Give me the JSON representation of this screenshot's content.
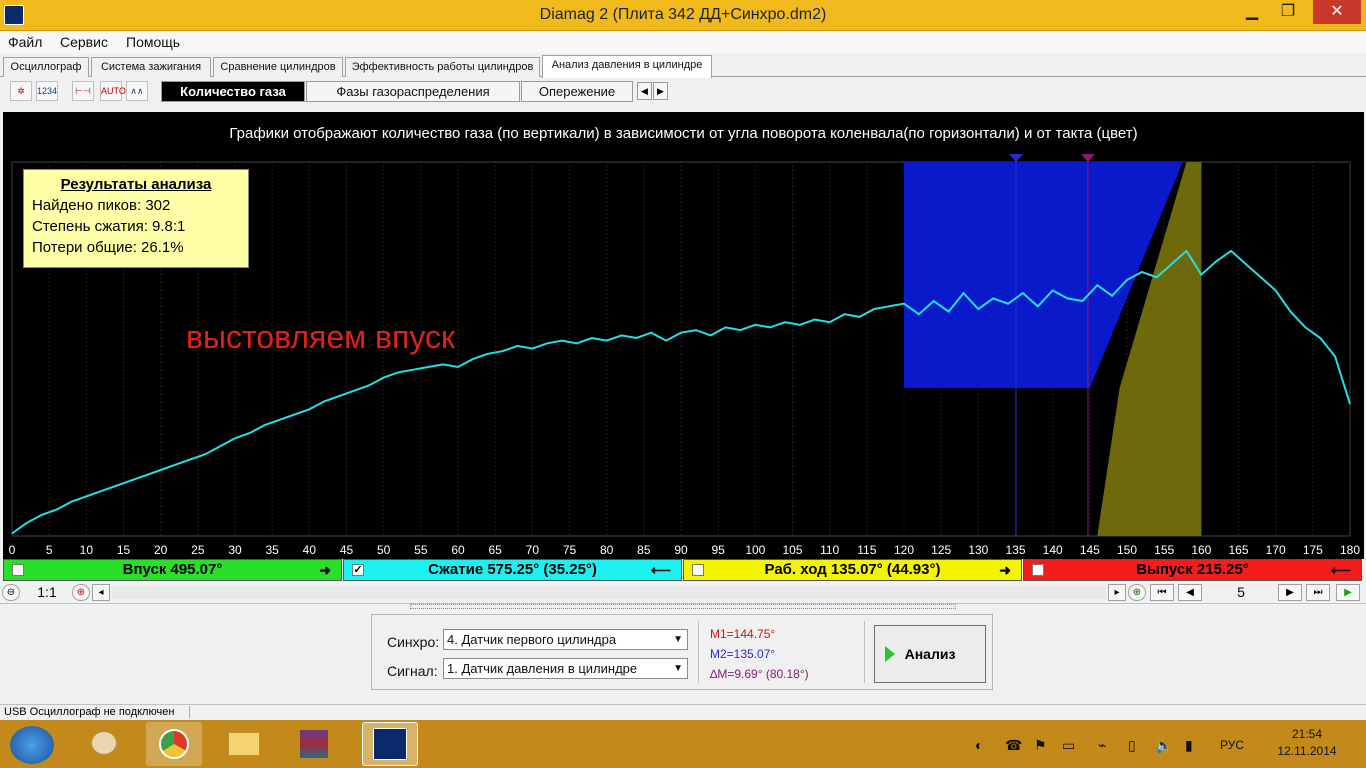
{
  "window": {
    "title": "Diamag 2 (Плита 342 ДД+Синхро.dm2)",
    "min": "▁",
    "max": "❐",
    "close": "✕"
  },
  "menu": [
    "Файл",
    "Сервис",
    "Помощь"
  ],
  "tabs": [
    "Осциллограф",
    "Система зажигания",
    "Сравнение цилиндров",
    "Эффективность работы цилиндров",
    "Анализ давления в цилиндре"
  ],
  "toolbar": {
    "icons": [
      "gear-icon",
      "1234-icon",
      "bracket-icon",
      "auto-icon",
      "wave-icon"
    ]
  },
  "subtabs": [
    "Количество газа",
    "Фазы газораспределения",
    "Опережение"
  ],
  "chart": {
    "caption": "Графики отображают количество газа (по вертикали) в зависимости от угла поворота коленвала(по горизонтали) и от такта (цвет)",
    "results": {
      "title": "Результаты анализа",
      "peaks": "Найдено пиков: 302",
      "compression": "Степень сжатия: 9.8:1",
      "losses": "Потери общие: 26.1%"
    },
    "annotation": "выстовляем впуск",
    "colors": {
      "line": "#22e0e6",
      "blue": "#0a19c9",
      "olive": "#6e690a",
      "m1": "#8b1a7a",
      "m2": "#2a2ad0"
    },
    "xticks": [
      "0",
      "5",
      "10",
      "15",
      "20",
      "25",
      "30",
      "35",
      "40",
      "45",
      "50",
      "55",
      "60",
      "65",
      "70",
      "75",
      "80",
      "85",
      "90",
      "95",
      "100",
      "105",
      "110",
      "115",
      "120",
      "125",
      "130",
      "135",
      "140",
      "145",
      "150",
      "155",
      "160",
      "165",
      "170",
      "175",
      "180"
    ]
  },
  "chart_data": {
    "type": "line",
    "xlim": [
      0,
      180
    ],
    "ylim": [
      0,
      1
    ],
    "x": [
      0,
      2,
      4,
      6,
      8,
      10,
      12,
      14,
      16,
      18,
      20,
      22,
      24,
      26,
      28,
      30,
      32,
      34,
      36,
      38,
      40,
      42,
      44,
      46,
      48,
      50,
      52,
      54,
      56,
      58,
      60,
      62,
      64,
      66,
      68,
      70,
      72,
      74,
      76,
      78,
      80,
      82,
      84,
      86,
      88,
      90,
      92,
      94,
      96,
      98,
      100,
      102,
      104,
      106,
      108,
      110,
      112,
      114,
      116,
      118,
      120,
      122,
      124,
      126,
      128,
      130,
      132,
      134,
      136,
      138,
      140,
      142,
      144,
      146,
      148,
      150,
      152,
      154,
      156,
      158,
      160,
      162,
      164,
      166,
      168,
      170,
      172,
      174,
      176,
      178,
      180
    ],
    "y": [
      0.01,
      0.05,
      0.08,
      0.1,
      0.13,
      0.15,
      0.17,
      0.19,
      0.21,
      0.23,
      0.25,
      0.27,
      0.29,
      0.31,
      0.34,
      0.37,
      0.39,
      0.42,
      0.44,
      0.46,
      0.48,
      0.51,
      0.53,
      0.55,
      0.57,
      0.6,
      0.62,
      0.63,
      0.64,
      0.65,
      0.64,
      0.67,
      0.69,
      0.7,
      0.72,
      0.71,
      0.73,
      0.74,
      0.73,
      0.75,
      0.74,
      0.76,
      0.75,
      0.77,
      0.74,
      0.77,
      0.78,
      0.76,
      0.79,
      0.78,
      0.8,
      0.79,
      0.81,
      0.8,
      0.82,
      0.81,
      0.84,
      0.83,
      0.86,
      0.87,
      0.88,
      0.84,
      0.89,
      0.85,
      0.92,
      0.86,
      0.9,
      0.88,
      0.92,
      0.87,
      0.93,
      0.9,
      0.89,
      0.95,
      0.91,
      0.97,
      1.0,
      0.98,
      1.03,
      1.08,
      0.99,
      1.04,
      1.08,
      1.03,
      0.98,
      0.93,
      0.85,
      0.79,
      0.75,
      0.68,
      0.5
    ]
  },
  "phases": {
    "intake": "Впуск 495.07°",
    "compression": "Сжатие 575.25° (35.25°)",
    "power": "Раб. ход 135.07° (44.93°)",
    "exhaust": "Выпуск 215.25°"
  },
  "zoom": {
    "ratio": "1:1",
    "page": "5"
  },
  "controls": {
    "sync_label": "Синхро:",
    "sync_value": "4. Датчик первого цилиндра",
    "signal_label": "Сигнал:",
    "signal_value": "1. Датчик давления в цилиндре",
    "m1": "M1=144.75°",
    "m2": "M2=135.07°",
    "dm": "∆M=9.69° (80.18°)",
    "analyze": "Анализ"
  },
  "status": {
    "usb": "USB Осциллограф не подключен"
  },
  "taskbar": {
    "lang": "РУС",
    "time": "21:54",
    "date": "12.11.2014"
  }
}
